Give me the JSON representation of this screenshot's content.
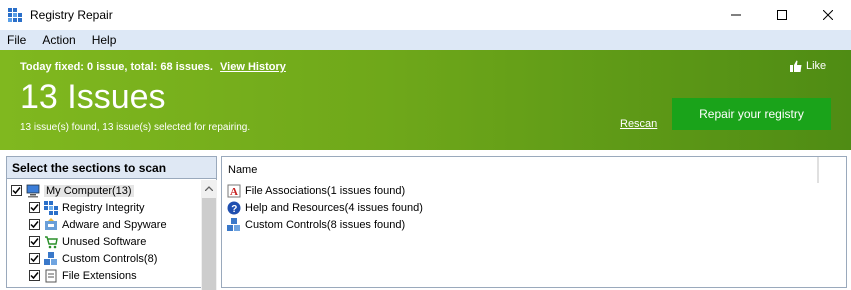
{
  "window": {
    "title": "Registry Repair",
    "icon": "registry-grid-icon"
  },
  "menu": [
    "File",
    "Action",
    "Help"
  ],
  "banner": {
    "summary": "Today fixed: 0 issue, total: 68 issues.",
    "view_history": "View History",
    "like": "Like",
    "title": "13 Issues",
    "subtitle": "13 issue(s) found, 13 issue(s) selected for repairing.",
    "rescan": "Rescan",
    "repair_button": "Repair your registry"
  },
  "left_panel": {
    "header": "Select the sections to scan",
    "items": [
      {
        "label": "My Computer(13)",
        "checked": true,
        "icon": "computer-icon"
      },
      {
        "label": "Registry Integrity",
        "checked": true,
        "icon": "registry-icon"
      },
      {
        "label": "Adware and Spyware",
        "checked": true,
        "icon": "spyware-icon"
      },
      {
        "label": "Unused Software",
        "checked": true,
        "icon": "cart-icon"
      },
      {
        "label": "Custom Controls(8)",
        "checked": true,
        "icon": "controls-icon"
      },
      {
        "label": "File Extensions",
        "checked": true,
        "icon": "file-icon"
      }
    ]
  },
  "right_panel": {
    "column": "Name",
    "items": [
      {
        "label": "File Associations(1 issues found)",
        "icon": "file-association-icon"
      },
      {
        "label": "Help and Resources(4 issues found)",
        "icon": "help-icon"
      },
      {
        "label": "Custom Controls(8 issues found)",
        "icon": "controls-icon"
      }
    ]
  },
  "colors": {
    "banner_start": "#80b81f",
    "banner_end": "#4f8c14",
    "repair_button": "#1aa31a",
    "menubar": "#dde8f6"
  }
}
